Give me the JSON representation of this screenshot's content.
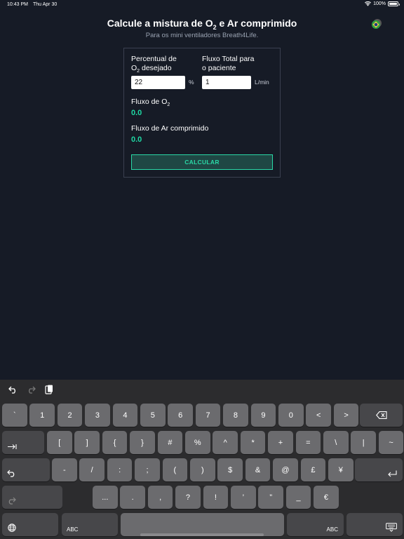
{
  "status_bar": {
    "time": "10:43 PM",
    "date": "Thu Apr 30",
    "battery": "100%"
  },
  "header": {
    "title_pre": "Calcule a mistura de O",
    "title_sub": "2",
    "title_post": " e Ar comprimido",
    "subtitle": "Para os mini ventiladores Breath4Life."
  },
  "form": {
    "o2_label_line1": "Percentual de",
    "o2_label_line2_pre": "O",
    "o2_label_line2_sub": "2",
    "o2_label_line2_post": " desejado",
    "o2_value": "22",
    "o2_unit": "%",
    "flow_label_line1": "Fluxo Total para",
    "flow_label_line2": "o paciente",
    "flow_value": "1",
    "flow_unit": "L/min",
    "o2_flow_label_pre": "Fluxo de O",
    "o2_flow_label_sub": "2",
    "o2_flow_value": "0.0",
    "air_flow_label": "Fluxo de Ar comprimido",
    "air_flow_value": "0.0",
    "calculate_label": "CALCULAR"
  },
  "colors": {
    "accent": "#2ad8a6",
    "background": "#161b26"
  },
  "keyboard": {
    "row1": [
      "`",
      "1",
      "2",
      "3",
      "4",
      "5",
      "6",
      "7",
      "8",
      "9",
      "0",
      "<",
      ">"
    ],
    "row2": [
      "[",
      "]",
      "{",
      "}",
      "#",
      "%",
      "^",
      "*",
      "+",
      "=",
      "\\",
      "|",
      "~"
    ],
    "row3": [
      "-",
      "/",
      ":",
      ";",
      "(",
      ")",
      "$",
      "&",
      "@",
      "£",
      "¥"
    ],
    "row4": [
      "...",
      ".",
      ",",
      "?",
      "!",
      "’",
      "”",
      "_",
      "€"
    ],
    "abc_label": "ABC"
  }
}
